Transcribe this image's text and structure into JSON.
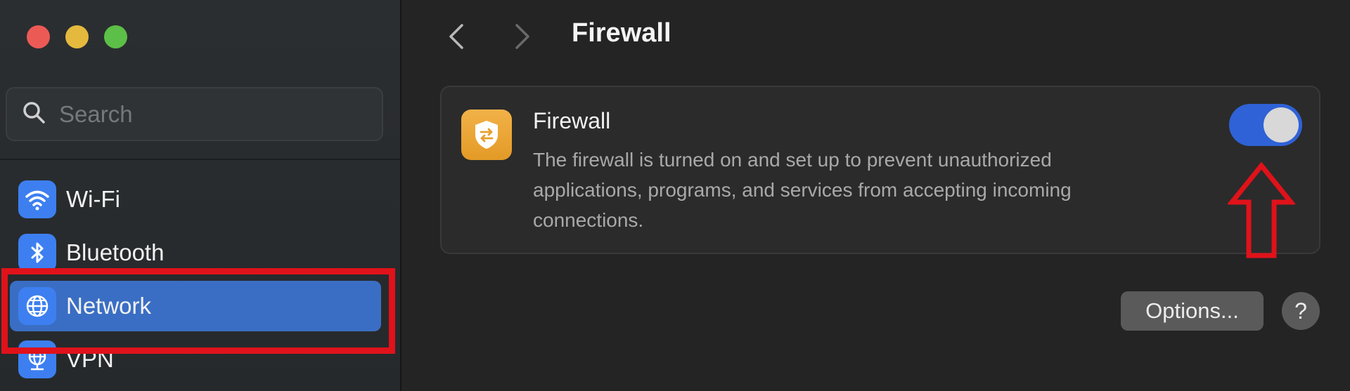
{
  "window": {
    "traffic_lights": {
      "close": "#ec5a56",
      "minimize": "#e4b93d",
      "maximize": "#5cbf47"
    }
  },
  "sidebar": {
    "search": {
      "placeholder": "Search",
      "icon": "search-icon"
    },
    "items": [
      {
        "label": "Wi-Fi",
        "icon": "wifi-icon",
        "selected": false
      },
      {
        "label": "Bluetooth",
        "icon": "bluetooth-icon",
        "selected": false
      },
      {
        "label": "Network",
        "icon": "globe-icon",
        "selected": true
      },
      {
        "label": "VPN",
        "icon": "vpn-globe-icon",
        "selected": false
      }
    ],
    "selected_color": "#3a6ec4"
  },
  "main": {
    "title": "Firewall",
    "back_icon": "chevron-left-icon",
    "forward_icon": "chevron-right-icon",
    "card": {
      "icon": "firewall-shield-icon",
      "title": "Firewall",
      "description": "The firewall is turned on and set up to prevent unauthorized applications, programs, and services from accepting incoming connections.",
      "toggle_on": true,
      "toggle_color": "#2f62d6"
    },
    "options_label": "Options...",
    "help_label": "?"
  },
  "annotations": {
    "highlight_color": "#e0121a",
    "highlight_target": "Network",
    "arrow_target": "firewall-toggle"
  }
}
